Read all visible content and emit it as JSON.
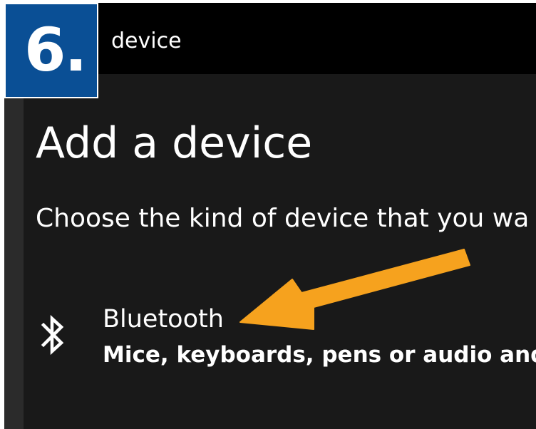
{
  "window": {
    "title": "device"
  },
  "step_badge": {
    "label": "6."
  },
  "page": {
    "title": "Add a device",
    "subtitle": "Choose the kind of device that you wa"
  },
  "options": [
    {
      "icon": "bluetooth-icon",
      "title": "Bluetooth",
      "description": "Mice, keyboards, pens or audio and ot"
    }
  ],
  "colors": {
    "titlebar": "#000000",
    "content_background": "#191919",
    "badge": "#0a4f95",
    "arrow": "#f6a21e",
    "text": "#ffffff"
  }
}
